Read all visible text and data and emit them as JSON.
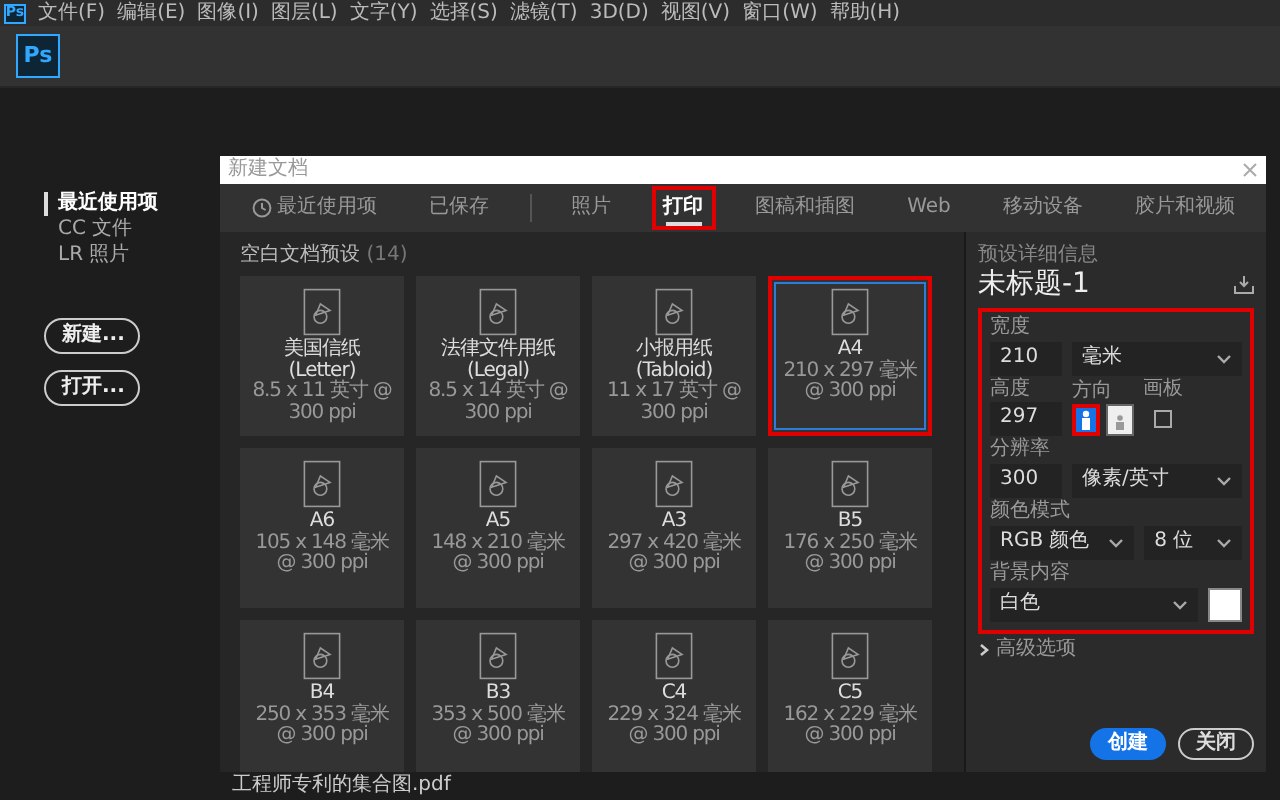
{
  "menubar": {
    "logo": "Ps",
    "items": [
      "文件(F)",
      "编辑(E)",
      "图像(I)",
      "图层(L)",
      "文字(Y)",
      "选择(S)",
      "滤镜(T)",
      "3D(D)",
      "视图(V)",
      "窗口(W)",
      "帮助(H)"
    ]
  },
  "toolbar": {
    "logo": "Ps"
  },
  "sidebar": {
    "items": [
      {
        "label": "最近使用项",
        "selected": true
      },
      {
        "label": "CC 文件",
        "selected": false
      },
      {
        "label": "LR 照片",
        "selected": false
      }
    ],
    "buttons": [
      "新建...",
      "打开..."
    ]
  },
  "dialog": {
    "title": "新建文档",
    "tabs": [
      {
        "label": "最近使用项",
        "selected": false,
        "highlighted": false,
        "kind": "recent"
      },
      {
        "label": "已保存",
        "selected": false,
        "highlighted": false,
        "kind": "plain"
      },
      {
        "label": "照片",
        "selected": false,
        "highlighted": false,
        "kind": "plain"
      },
      {
        "label": "打印",
        "selected": true,
        "highlighted": true,
        "kind": "plain"
      },
      {
        "label": "图稿和插图",
        "selected": false,
        "highlighted": false,
        "kind": "plain"
      },
      {
        "label": "Web",
        "selected": false,
        "highlighted": false,
        "kind": "plain"
      },
      {
        "label": "移动设备",
        "selected": false,
        "highlighted": false,
        "kind": "plain"
      },
      {
        "label": "胶片和视频",
        "selected": false,
        "highlighted": false,
        "kind": "plain"
      }
    ],
    "presets": {
      "heading": "空白文档预设",
      "count": "(14)",
      "items": [
        {
          "name": "美国信纸 (Letter)",
          "size": "8.5 x 11 英寸 @ 300 ppi",
          "selected": false,
          "highlighted": false
        },
        {
          "name": "法律文件用纸 (Legal)",
          "size": "8.5 x 14 英寸 @ 300 ppi",
          "selected": false,
          "highlighted": false
        },
        {
          "name": "小报用纸 (Tabloid)",
          "size": "11 x 17 英寸 @ 300 ppi",
          "selected": false,
          "highlighted": false
        },
        {
          "name": "A4",
          "size": "210 x 297 毫米 @ 300 ppi",
          "selected": true,
          "highlighted": true
        },
        {
          "name": "A6",
          "size": "105 x 148 毫米 @ 300 ppi",
          "selected": false,
          "highlighted": false
        },
        {
          "name": "A5",
          "size": "148 x 210 毫米 @ 300 ppi",
          "selected": false,
          "highlighted": false
        },
        {
          "name": "A3",
          "size": "297 x 420 毫米 @ 300 ppi",
          "selected": false,
          "highlighted": false
        },
        {
          "name": "B5",
          "size": "176 x 250 毫米 @ 300 ppi",
          "selected": false,
          "highlighted": false
        },
        {
          "name": "B4",
          "size": "250 x 353 毫米 @ 300 ppi",
          "selected": false,
          "highlighted": false
        },
        {
          "name": "B3",
          "size": "353 x 500 毫米 @ 300 ppi",
          "selected": false,
          "highlighted": false
        },
        {
          "name": "C4",
          "size": "229 x 324 毫米 @ 300 ppi",
          "selected": false,
          "highlighted": false
        },
        {
          "name": "C5",
          "size": "162 x 229 毫米 @ 300 ppi",
          "selected": false,
          "highlighted": false
        }
      ]
    },
    "details": {
      "heading": "预设详细信息",
      "doc_title": "未标题-1",
      "highlighted": true,
      "width": {
        "label": "宽度",
        "value": "210",
        "unit": "毫米"
      },
      "height": {
        "label": "高度",
        "value": "297"
      },
      "orientation": {
        "label": "方向",
        "options": [
          {
            "kind": "portrait",
            "selected": true,
            "highlighted": true
          },
          {
            "kind": "landscape",
            "selected": false,
            "highlighted": false
          }
        ]
      },
      "artboard": {
        "label": "画板",
        "checked": false
      },
      "resolution": {
        "label": "分辨率",
        "value": "300",
        "unit": "像素/英寸"
      },
      "color_mode": {
        "label": "颜色模式",
        "value": "RGB 颜色",
        "depth": "8 位"
      },
      "background": {
        "label": "背景内容",
        "value": "白色",
        "color": "#ffffff"
      },
      "advanced": {
        "label": "高级选项",
        "expanded": false
      },
      "buttons": {
        "create": "创建",
        "close": "关闭"
      }
    }
  },
  "footer_text": "工程师专利的集合图.pdf"
}
